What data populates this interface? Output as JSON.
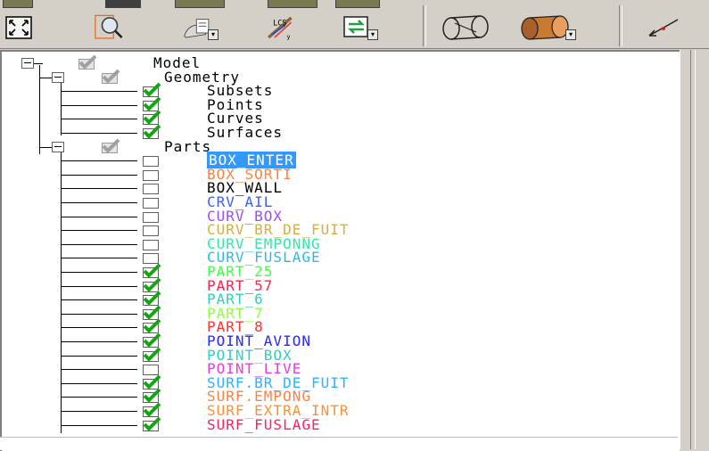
{
  "tree": {
    "root": {
      "label": "Model"
    },
    "geometry": {
      "label": "Geometry",
      "items": [
        {
          "label": "Subsets",
          "checked": true
        },
        {
          "label": "Points",
          "checked": true
        },
        {
          "label": "Curves",
          "checked": true
        },
        {
          "label": "Surfaces",
          "checked": true
        }
      ]
    },
    "parts": {
      "label": "Parts",
      "items": [
        {
          "label": "BOX_ENTER",
          "checked": false,
          "color": "#ffffff",
          "selected": true
        },
        {
          "label": "BOX_SORTI",
          "checked": false,
          "color": "#ff8040"
        },
        {
          "label": "BOX_WALL",
          "checked": false,
          "color": "#000000"
        },
        {
          "label": "CRV_AIL",
          "checked": false,
          "color": "#3c5cff"
        },
        {
          "label": "CURV_BOX",
          "checked": false,
          "color": "#9a4cff"
        },
        {
          "label": "CURV_BR_DE_FUIT",
          "checked": false,
          "color": "#d4b040"
        },
        {
          "label": "CURV_EMPONNG",
          "checked": false,
          "color": "#2ee8a8"
        },
        {
          "label": "CURV_FUSLAGE",
          "checked": false,
          "color": "#30b8e0"
        },
        {
          "label": "PART_25",
          "checked": true,
          "color": "#40ff40"
        },
        {
          "label": "PART_57",
          "checked": true,
          "color": "#ff2050"
        },
        {
          "label": "PART_6",
          "checked": true,
          "color": "#30d0b8"
        },
        {
          "label": "PART_7",
          "checked": true,
          "color": "#90ff40"
        },
        {
          "label": "PART_8",
          "checked": true,
          "color": "#ff3030"
        },
        {
          "label": "POINT_AVION",
          "checked": true,
          "color": "#2828ff"
        },
        {
          "label": "POINT_BOX",
          "checked": true,
          "color": "#30d0c0"
        },
        {
          "label": "POINT_LIVE",
          "checked": false,
          "color": "#e040e0"
        },
        {
          "label": "SURF.BR_DE_FUIT",
          "checked": true,
          "color": "#30b0ff"
        },
        {
          "label": "SURF.EMPONG",
          "checked": true,
          "color": "#ff8040"
        },
        {
          "label": "SURF_EXTRA_INTR",
          "checked": true,
          "color": "#ff9030"
        },
        {
          "label": "SURF_FUSLAGE",
          "checked": true,
          "color": "#ff2060"
        }
      ]
    }
  },
  "toolbar": {
    "buttons": [
      {
        "icon": "fit-window-icon"
      },
      {
        "icon": "zoom-box-icon"
      },
      {
        "icon": "view-options-icon"
      },
      {
        "icon": "local-coord-system-icon"
      },
      {
        "icon": "refresh-view-icon"
      },
      {
        "icon": "wireframe-cylinder-icon"
      },
      {
        "icon": "solid-cylinder-icon"
      },
      {
        "icon": "measure-icon"
      }
    ]
  },
  "colors": {
    "check_green": "#10a810",
    "selection_blue": "#3399ff",
    "panel_gray": "#d4d0c8"
  }
}
